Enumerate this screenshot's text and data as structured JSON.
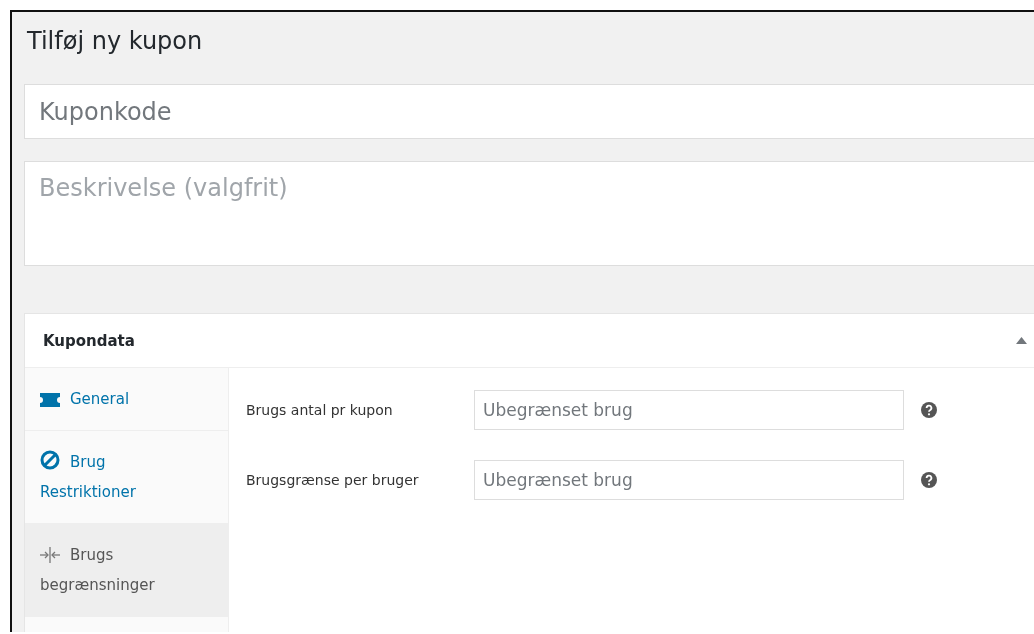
{
  "page": {
    "title": "Tilføj ny kupon"
  },
  "code_field": {
    "placeholder": "Kuponkode"
  },
  "description_field": {
    "placeholder": "Beskrivelse (valgfrit)"
  },
  "panel": {
    "title": "Kupondata",
    "expanded": true,
    "tabs": [
      {
        "kind": "ticket",
        "label": "General",
        "selected": false
      },
      {
        "kind": "ban",
        "label": "Brug Restriktioner",
        "selected": false
      },
      {
        "kind": "limit",
        "label": "Brugs begrænsninger",
        "selected": true
      }
    ],
    "fields": [
      {
        "label": "Brugs antal pr kupon",
        "placeholder": "Ubegrænset brug"
      },
      {
        "label": "Brugsgrænse per bruger",
        "placeholder": "Ubegrænset brug"
      }
    ]
  }
}
